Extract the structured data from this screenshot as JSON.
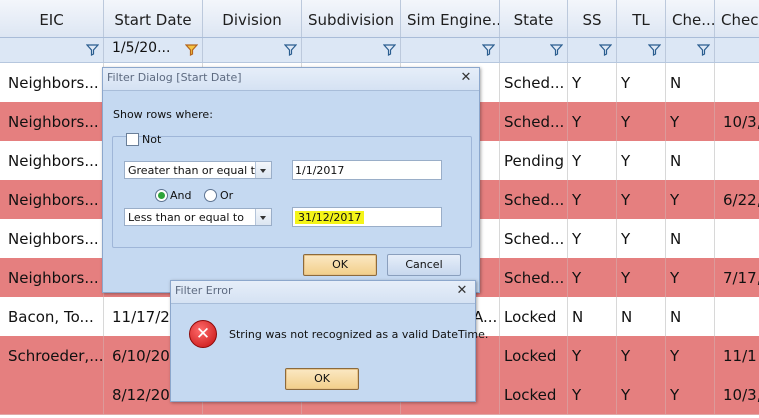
{
  "grid": {
    "headers": [
      "EIC",
      "Start Date",
      "Division",
      "Subdivision",
      "Sim Engine...",
      "State",
      "SS",
      "TL",
      "Che...",
      "Chec"
    ],
    "filter_values": [
      "",
      "1/5/20...",
      "",
      "",
      "",
      "",
      "",
      "",
      "",
      ""
    ],
    "rows": [
      {
        "eic": "Neighbors...",
        "start": "",
        "state": "Sched...",
        "ss": "Y",
        "tl": "Y",
        "che": "N",
        "chec": ""
      },
      {
        "eic": "Neighbors...",
        "start": "",
        "state": "Sched...",
        "ss": "Y",
        "tl": "Y",
        "che": "Y",
        "chec": "10/3,"
      },
      {
        "eic": "Neighbors...",
        "start": "",
        "state": "Pending",
        "ss": "Y",
        "tl": "Y",
        "che": "N",
        "chec": ""
      },
      {
        "eic": "Neighbors...",
        "start": "",
        "state": "Sched...",
        "ss": "Y",
        "tl": "Y",
        "che": "Y",
        "chec": "6/22,"
      },
      {
        "eic": "Neighbors...",
        "start": "",
        "state": "Sched...",
        "ss": "Y",
        "tl": "Y",
        "che": "N",
        "chec": ""
      },
      {
        "eic": "Neighbors...",
        "start": "",
        "state": "Sched...",
        "ss": "Y",
        "tl": "Y",
        "che": "Y",
        "chec": "7/17,"
      },
      {
        "eic": "Bacon,  To...",
        "start": "11/17/2",
        "sim": "A...",
        "state": "Locked",
        "ss": "N",
        "tl": "N",
        "che": "N",
        "chec": ""
      },
      {
        "eic": "Schroeder,...",
        "start": "6/10/20",
        "state": "Locked",
        "ss": "Y",
        "tl": "Y",
        "che": "Y",
        "chec": "11/1"
      },
      {
        "eic": "",
        "start": "8/12/20",
        "state": "Locked",
        "ss": "Y",
        "tl": "Y",
        "che": "Y",
        "chec": "10/3,"
      }
    ]
  },
  "filter_dialog": {
    "title": "Filter Dialog [Start Date]",
    "show_rows_label": "Show rows where:",
    "not_label": "Not",
    "not_checked": false,
    "operator1": "Greater than or equal to",
    "value1": "1/1/2017",
    "and_label": "And",
    "or_label": "Or",
    "logic_selected": "And",
    "operator2": "Less than or equal to",
    "value2": "31/12/2017",
    "ok_label": "OK",
    "cancel_label": "Cancel"
  },
  "error_dialog": {
    "title": "Filter Error",
    "message": "String was not recognized as a valid DateTime.",
    "ok_label": "OK",
    "icon": "error-icon"
  },
  "colors": {
    "row_highlight": "#e57f7f",
    "dialog_background": "#c5d9f1",
    "value_highlight": "#f4f418",
    "error_icon": "#d01a1a"
  }
}
